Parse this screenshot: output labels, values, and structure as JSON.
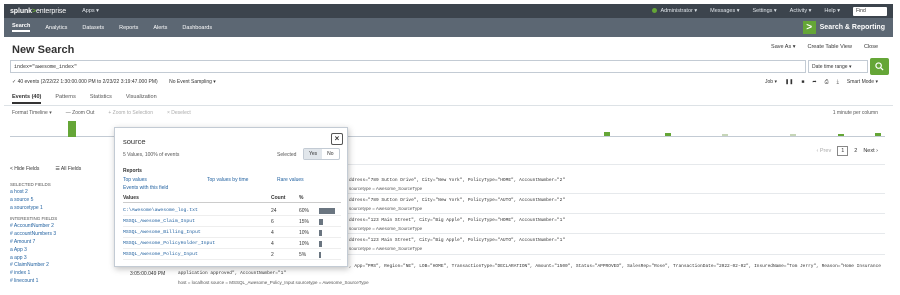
{
  "topbar": {
    "brand_splunk": "splunk",
    "brand_gt": ">",
    "brand_ent": "enterprise",
    "apps": "Apps ▾",
    "user": "Administrator ▾",
    "messages": "Messages ▾",
    "settings": "Settings ▾",
    "activity": "Activity ▾",
    "help": "Help ▾",
    "find_placeholder": "Find"
  },
  "appbar": {
    "nav": [
      "Search",
      "Analytics",
      "Datasets",
      "Reports",
      "Alerts",
      "Dashboards"
    ],
    "app_logo": ">",
    "app_title": "Search & Reporting"
  },
  "page": {
    "title": "New Search",
    "save_as": "Save As ▾",
    "create_table_view": "Create Table View",
    "close": "Close"
  },
  "search": {
    "query": "index=\"awesome_index\"",
    "time_range": "Date time range ▾",
    "search_icon": "search-icon"
  },
  "status": {
    "events": "✓ 40 events (2/22/22 1:30:00.000 PM to 2/23/22 3:19:47.000 PM)",
    "sampling": "No Event Sampling ▾",
    "job": "Job ▾",
    "smart_mode": "Smart Mode ▾"
  },
  "tabs": [
    "Events (40)",
    "Patterns",
    "Statistics",
    "Visualization"
  ],
  "timeline": {
    "format": "Format Timeline ▾",
    "zoom_out": "— Zoom Out",
    "zoom_selection": "+ Zoom to Selection",
    "deselect": "× Deselect",
    "per_column": "1 minute per column"
  },
  "pager": {
    "prev": "‹ Prev",
    "p1": "1",
    "p2": "2",
    "next": "Next ›"
  },
  "sidebar": {
    "hide_fields": "< Hide Fields",
    "all_fields": "☰ All Fields",
    "selected_label": "SELECTED FIELDS",
    "selected": [
      "a host 2",
      "a source 5",
      "a sourcetype 1"
    ],
    "interesting_label": "INTERESTING FIELDS",
    "interesting": [
      "# AccountNumber 2",
      "# accountNumbers 3",
      "# Amount 7",
      "a App 3",
      "a app 3",
      "# ClaimNumber 2",
      "# index 1",
      "# linecount 1"
    ]
  },
  "events": {
    "rows": [
      {
        "text": "ddress=\"789 Sutton Drive\", City=\"New York\", PolicyType=\"HOME\", AccountNumber=\"2\"",
        "meta": "sourcetype = Awesome_SourceType"
      },
      {
        "text": "ddress=\"789 Sutton Drive\", City=\"New York\", PolicyType=\"AUTO\", AccountNumber=\"2\"",
        "meta": "sourcetype = Awesome_SourceType"
      },
      {
        "text": "ddress=\"123 Main Street\", City=\"Big Apple\", PolicyType=\"HOME\", AccountNumber=\"1\"",
        "meta": "sourcetype = Awesome_SourceType"
      },
      {
        "text": "ddress=\"123 Main Street\", City=\"Big Apple\", PolicyType=\"AUTO\", AccountNumber=\"1\"",
        "meta": "sourcetype = Awesome_SourceType"
      }
    ],
    "long_line1": ", App=\"PMS\", Region=\"NE\", LOB=\"HOME\", TransactionType=\"DECLARATION\", Amount=\"1500\", Status=\"APPROVED\", SalesRep=\"Rose\", TransactionDate=\"2022-02-02\", InsuredName=\"Tom Jerry\", Reason=\"Home Insurance",
    "long_line2": "application approved\", AccountNumber=\"1\"",
    "last_time": "3:05:00.049 PM",
    "last_meta": "host = localhost    source = MSSQL_Awesome_Policy_Input    sourcetype = Awesome_SourceType"
  },
  "popover": {
    "title": "source",
    "summary": "5 Values, 100% of events",
    "selected_label": "Selected",
    "yes": "Yes",
    "no": "No",
    "reports_label": "Reports",
    "top_values": "Top values",
    "top_values_time": "Top values by time",
    "rare_values": "Rare values",
    "events_with_field": "Events with this field",
    "col_values": "Values",
    "col_count": "Count",
    "col_pct": "%",
    "rows": [
      {
        "value": "C:\\Awesome\\awesome_log.txt",
        "count": "24",
        "pct": "60%",
        "frac": 0.6
      },
      {
        "value": "MSSQL_Awesome_Claim_Input",
        "count": "6",
        "pct": "15%",
        "frac": 0.15
      },
      {
        "value": "MSSQL_Awesome_Billing_Input",
        "count": "4",
        "pct": "10%",
        "frac": 0.1
      },
      {
        "value": "MSSQL_Awesome_PolicyHolder_Input",
        "count": "4",
        "pct": "10%",
        "frac": 0.1
      },
      {
        "value": "MSSQL_Awesome_Policy_Input",
        "count": "2",
        "pct": "5%",
        "frac": 0.05
      }
    ]
  },
  "colors": {
    "accent": "#65a637",
    "topbar": "#3c444d",
    "appbar": "#5c6773",
    "link": "#1e5f9f"
  }
}
